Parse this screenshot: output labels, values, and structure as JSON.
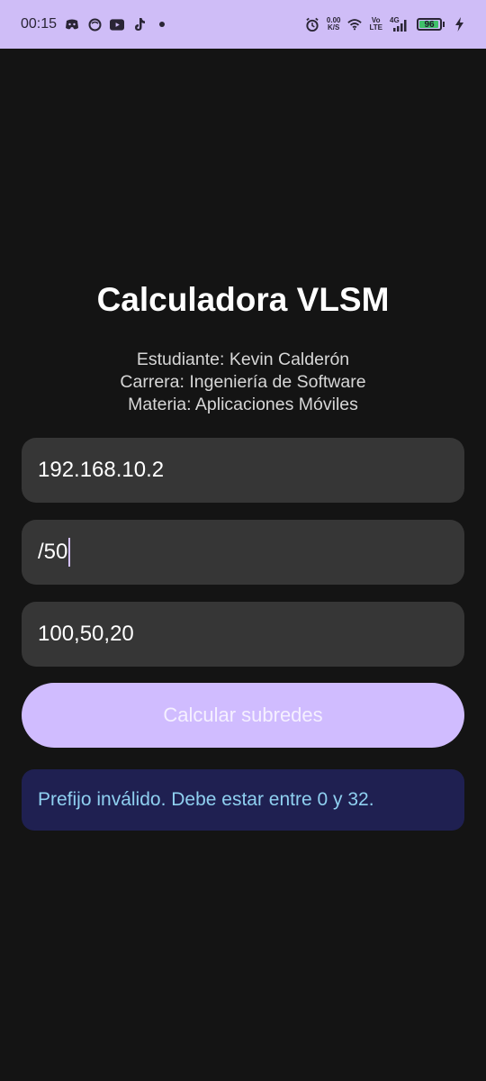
{
  "status_bar": {
    "time": "00:15",
    "net_speed_value": "0.00",
    "net_speed_unit": "K/S",
    "volte_top": "Vo",
    "volte_bottom": "LTE",
    "network": "4G",
    "battery": "96",
    "battery_level": 0.96,
    "icons": [
      "discord-icon",
      "ghost-icon",
      "youtube-icon",
      "tiktok-icon",
      "dot-icon",
      "alarm-icon",
      "wifi-icon",
      "signal-icon",
      "charging-icon"
    ]
  },
  "app": {
    "title": "Calculadora VLSM",
    "student": "Estudiante: Kevin Calderón",
    "career": "Carrera: Ingeniería de Software",
    "subject": "Materia: Aplicaciones Móviles"
  },
  "form": {
    "ip_value": "192.168.10.2",
    "prefix_value": "/50",
    "hosts_value": "100,50,20",
    "calculate_label": "Calcular subredes"
  },
  "error": {
    "message": "Prefijo inválido. Debe estar entre 0 y 32."
  },
  "colors": {
    "accent": "#d0bcff",
    "background": "#141414",
    "field": "#363636",
    "error_bg": "#1f2051",
    "error_text": "#8fd0f0"
  }
}
